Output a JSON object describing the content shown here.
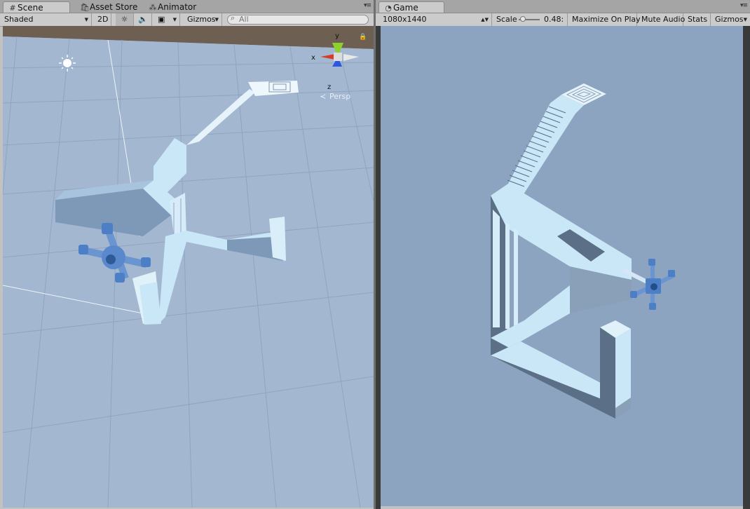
{
  "scene_panel": {
    "tabs": [
      {
        "label": "Scene",
        "icon": "grid-icon",
        "active": true
      },
      {
        "label": "Asset Store",
        "icon": "store-icon",
        "active": false
      },
      {
        "label": "Animator",
        "icon": "animator-icon",
        "active": false
      }
    ],
    "toolbar": {
      "shading_mode": "Shaded",
      "mode_2d": "2D",
      "gizmos_label": "Gizmos",
      "search_placeholder": "All"
    },
    "view": {
      "axis_y": "y",
      "axis_x": "x",
      "axis_z": "z",
      "projection": "Persp"
    }
  },
  "game_panel": {
    "tab": {
      "label": "Game",
      "icon": "pacman-icon"
    },
    "toolbar": {
      "resolution": "1080x1440",
      "scale_label": "Scale",
      "scale_value": "0.48:",
      "scale_fraction": 0.1,
      "maximize_on_play": "Maximize On Play",
      "mute_audio": "Mute Audio",
      "stats": "Stats",
      "gizmos_label": "Gizmos"
    }
  },
  "colors": {
    "scene_sky": "#6d5f52",
    "scene_ground": "#a9bdd6",
    "game_background": "#8da4c0",
    "structure_light": "#c9e7f6",
    "structure_dark": "#7e99b8",
    "handle_blue": "#4d7fc6",
    "axis_y": "#8fd12c",
    "axis_x": "#d73b2b",
    "axis_z": "#2c56e3"
  }
}
